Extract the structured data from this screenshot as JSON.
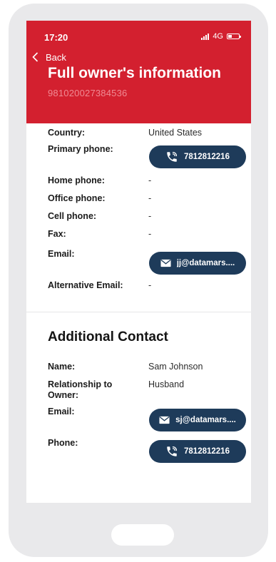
{
  "status_bar": {
    "time": "17:20",
    "network": "4G"
  },
  "header": {
    "back_label": "Back",
    "title": "Full owner's information",
    "subtitle": "981020027384536"
  },
  "owner_details": [
    {
      "label": "Country:",
      "value": "United States"
    },
    {
      "label": "Primary phone:",
      "value": "7812812216",
      "action": "phone"
    },
    {
      "label": "Home phone:",
      "value": "-"
    },
    {
      "label": "Office phone:",
      "value": "-"
    },
    {
      "label": "Cell phone:",
      "value": "-"
    },
    {
      "label": "Fax:",
      "value": "-"
    },
    {
      "label": "Email:",
      "value": "jj@datamars....",
      "action": "email"
    },
    {
      "label": "Alternative Email:",
      "value": "-"
    }
  ],
  "additional_contact": {
    "title": "Additional Contact",
    "rows": [
      {
        "label": "Name:",
        "value": "Sam Johnson"
      },
      {
        "label": "Relationship to Owner:",
        "value": "Husband"
      },
      {
        "label": "Email:",
        "value": "sj@datamars....",
        "action": "email"
      },
      {
        "label": "Phone:",
        "value": "7812812216",
        "action": "phone"
      }
    ]
  },
  "colors": {
    "header_bg": "#d3202f",
    "button_bg": "#1e3b5a",
    "phone_frame": "#e9e9eb"
  },
  "icons": {
    "back": "chevron-left-icon",
    "phone": "phone-call-icon",
    "email": "envelope-icon"
  }
}
